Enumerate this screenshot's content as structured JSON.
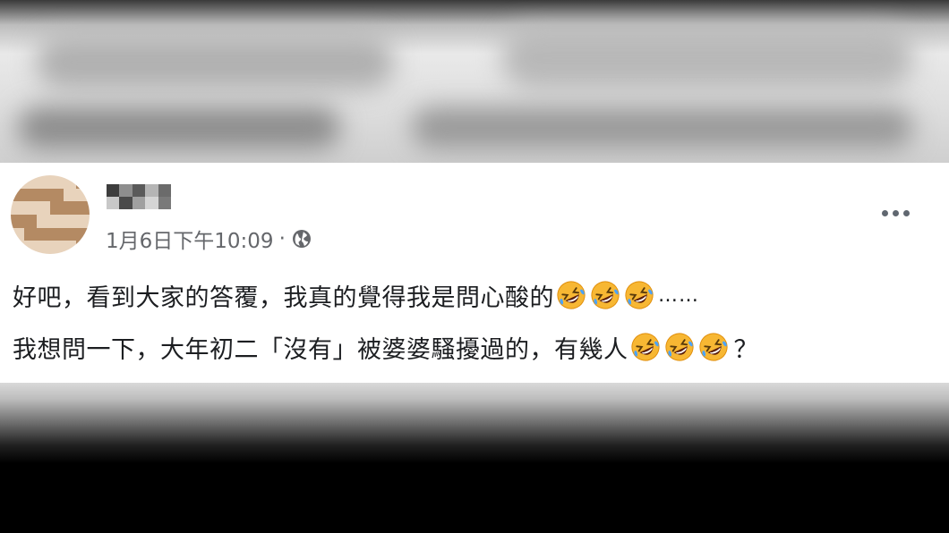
{
  "post": {
    "author_name": "",
    "timestamp": "1月6日下午10:09",
    "separator": "·",
    "privacy_icon": "globe-icon",
    "more_icon": "more-options-icon",
    "line1": {
      "text": "好吧，看到大家的答覆，我真的覺得我是問心酸的",
      "emoji": "rolling-on-floor-laughing",
      "emoji_count": 3,
      "suffix": "……"
    },
    "line2": {
      "text": "我想問一下，大年初二「沒有」被婆婆騷擾過的，有幾人",
      "emoji": "rolling-on-floor-laughing",
      "emoji_count": 3,
      "suffix": "？"
    }
  },
  "colors": {
    "text": "#1c1e21",
    "meta": "#65676b",
    "card_bg": "#ffffff"
  }
}
